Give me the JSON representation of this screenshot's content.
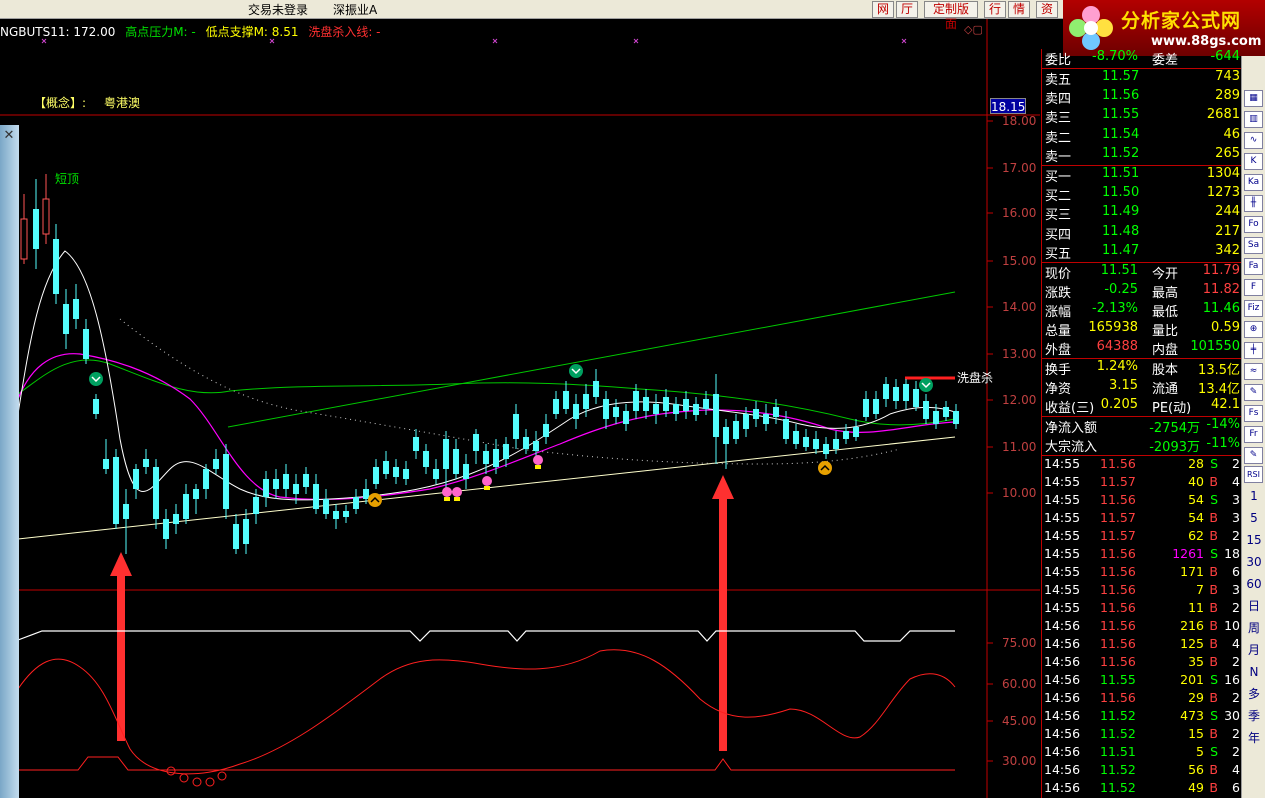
{
  "topbar": {
    "login_status": "交易未登录",
    "index_name": "深振业A",
    "buttons": [
      "网",
      "厅",
      "定制版面",
      "行",
      "情",
      "资"
    ]
  },
  "logo": {
    "title": "分析家公式网",
    "url_text": "www.88gs.com"
  },
  "legend": [
    {
      "text": "NGBUTS11: 172.00",
      "color": "#ffffff"
    },
    {
      "text": "高点压力M: -",
      "color": "#00e000"
    },
    {
      "text": "低点支撑M: 8.51",
      "color": "#ffff00"
    },
    {
      "text": "洗盘杀入线: -",
      "color": "#ff3030"
    }
  ],
  "concept": {
    "label": "【概念】:",
    "value": "粤港澳"
  },
  "chart": {
    "short_top_label": "短顶",
    "wash_label": "洗盘杀",
    "current_price_tag": "18.15",
    "price_axis": [
      "18.00",
      "17.00",
      "16.00",
      "15.00",
      "14.00",
      "13.00",
      "12.00",
      "11.00",
      "10.00"
    ],
    "indicator_axis": [
      "75.00",
      "60.00",
      "45.00",
      "30.00"
    ],
    "colors": {
      "up": "#ff5555",
      "down": "#54fcfc",
      "ma_white": "#ffffff",
      "ma_magenta": "#ff00ff",
      "ma_green": "#00c800",
      "support": "#ffff99",
      "arrow": "#ff3030"
    }
  },
  "quote": {
    "header": [
      {
        "l": "委比",
        "v": "-8.70%",
        "l2": "委差",
        "v2": "-644",
        "vc": "#00ff00",
        "v2c": "#00ff00"
      }
    ],
    "sell": [
      {
        "l": "卖五",
        "p": "11.57",
        "q": "743"
      },
      {
        "l": "卖四",
        "p": "11.56",
        "q": "289"
      },
      {
        "l": "卖三",
        "p": "11.55",
        "q": "2681"
      },
      {
        "l": "卖二",
        "p": "11.54",
        "q": "46"
      },
      {
        "l": "卖一",
        "p": "11.52",
        "q": "265"
      }
    ],
    "buy": [
      {
        "l": "买一",
        "p": "11.51",
        "q": "1304"
      },
      {
        "l": "买二",
        "p": "11.50",
        "q": "1273"
      },
      {
        "l": "买三",
        "p": "11.49",
        "q": "244"
      },
      {
        "l": "买四",
        "p": "11.48",
        "q": "217"
      },
      {
        "l": "买五",
        "p": "11.47",
        "q": "342"
      }
    ],
    "stats1": [
      {
        "l": "现价",
        "v": "11.51",
        "vc": "#00ff00",
        "l2": "今开",
        "v2": "11.79",
        "v2c": "#ff4040"
      },
      {
        "l": "涨跌",
        "v": "-0.25",
        "vc": "#00ff00",
        "l2": "最高",
        "v2": "11.82",
        "v2c": "#ff4040"
      },
      {
        "l": "涨幅",
        "v": "-2.13%",
        "vc": "#00ff00",
        "l2": "最低",
        "v2": "11.46",
        "v2c": "#00ff00"
      },
      {
        "l": "总量",
        "v": "165938",
        "vc": "#ffff00",
        "l2": "量比",
        "v2": "0.59",
        "v2c": "#ffff00"
      },
      {
        "l": "外盘",
        "v": "64388",
        "vc": "#ff4040",
        "l2": "内盘",
        "v2": "101550",
        "v2c": "#00ff00"
      }
    ],
    "stats2": [
      {
        "l": "换手",
        "v": "1.24%",
        "vc": "#ffff00",
        "l2": "股本",
        "v2": "13.5亿",
        "v2c": "#ffff00"
      },
      {
        "l": "净资",
        "v": "3.15",
        "vc": "#ffff00",
        "l2": "流通",
        "v2": "13.4亿",
        "v2c": "#ffff00"
      },
      {
        "l": "收益(三)",
        "v": "0.205",
        "vc": "#ffff00",
        "l2": "PE(动)",
        "v2": "42.1",
        "v2c": "#ffff00"
      }
    ],
    "flows": [
      {
        "l": "净流入额",
        "v": "-2754万",
        "v2": "-14%"
      },
      {
        "l": "大宗流入",
        "v": "-2093万",
        "v2": "-11%"
      }
    ],
    "ticks": [
      {
        "t": "14:55",
        "p": "11.56",
        "v": "28",
        "s": "S",
        "n": "2"
      },
      {
        "t": "14:55",
        "p": "11.57",
        "v": "40",
        "s": "B",
        "n": "4"
      },
      {
        "t": "14:55",
        "p": "11.56",
        "v": "54",
        "s": "S",
        "n": "3"
      },
      {
        "t": "14:55",
        "p": "11.57",
        "v": "54",
        "s": "B",
        "n": "3"
      },
      {
        "t": "14:55",
        "p": "11.57",
        "v": "62",
        "s": "B",
        "n": "2"
      },
      {
        "t": "14:55",
        "p": "11.56",
        "v": "1261",
        "s": "S",
        "n": "18"
      },
      {
        "t": "14:55",
        "p": "11.56",
        "v": "171",
        "s": "B",
        "n": "6"
      },
      {
        "t": "14:55",
        "p": "11.56",
        "v": "7",
        "s": "B",
        "n": "3"
      },
      {
        "t": "14:55",
        "p": "11.56",
        "v": "11",
        "s": "B",
        "n": "2"
      },
      {
        "t": "14:56",
        "p": "11.56",
        "v": "216",
        "s": "B",
        "n": "10"
      },
      {
        "t": "14:56",
        "p": "11.56",
        "v": "125",
        "s": "B",
        "n": "4"
      },
      {
        "t": "14:56",
        "p": "11.56",
        "v": "35",
        "s": "B",
        "n": "2"
      },
      {
        "t": "14:56",
        "p": "11.55",
        "v": "201",
        "s": "S",
        "n": "16"
      },
      {
        "t": "14:56",
        "p": "11.56",
        "v": "29",
        "s": "B",
        "n": "2"
      },
      {
        "t": "14:56",
        "p": "11.52",
        "v": "473",
        "s": "S",
        "n": "30"
      },
      {
        "t": "14:56",
        "p": "11.52",
        "v": "15",
        "s": "B",
        "n": "2"
      },
      {
        "t": "14:56",
        "p": "11.51",
        "v": "5",
        "s": "S",
        "n": "2"
      },
      {
        "t": "14:56",
        "p": "11.52",
        "v": "56",
        "s": "B",
        "n": "4"
      },
      {
        "t": "14:56",
        "p": "11.52",
        "v": "49",
        "s": "B",
        "n": "6"
      }
    ]
  },
  "right_toolbar": {
    "icons": [
      "chart-icon",
      "bar-icon",
      "line-icon",
      "k-icon",
      "ka-icon",
      "candle-icon",
      "fo-icon",
      "sa-icon",
      "fa-icon",
      "f-icon",
      "fiz-icon",
      "zoom-icon",
      "kline-icon",
      "wave-icon",
      "pen-icon",
      "fs-icon",
      "fr-icon",
      "pen2-icon"
    ],
    "icon_text": [
      "▦",
      "▥",
      "∿",
      "K",
      "Ka",
      "╫",
      "Fo",
      "Sa",
      "Fa",
      "F",
      "Fiz",
      "⊕",
      "╪",
      "≈",
      "✎",
      "Fs",
      "Fr",
      "✎"
    ],
    "labels": [
      "1",
      "5",
      "15",
      "30",
      "60",
      "日",
      "周",
      "月",
      "N",
      "多",
      "季",
      "年"
    ],
    "rsi": "RSI"
  }
}
